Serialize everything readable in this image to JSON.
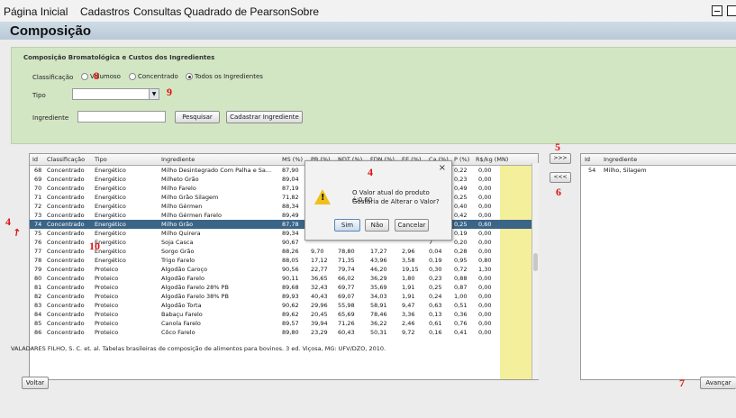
{
  "menu": [
    "Página Inicial",
    "Cadastros",
    "Consultas",
    "Quadrado de Pearson",
    "Sobre"
  ],
  "window_title": "Composição",
  "section_title": "Composição Bromatológica e Custos dos Ingredientes",
  "classificacao": {
    "label": "Classificação",
    "options": [
      "Volumoso",
      "Concentrado",
      "Todos os Ingredientes"
    ],
    "selected": "Todos os Ingredientes"
  },
  "tipo": {
    "label": "Tipo",
    "value": ""
  },
  "ingrediente": {
    "label": "Ingrediente",
    "value": ""
  },
  "buttons": {
    "pesquisar": "Pesquisar",
    "cadastrar": "Cadastrar Ingrediente",
    "add": ">>>",
    "remove": "<<<",
    "voltar": "Voltar",
    "avancar": "Avançar"
  },
  "table": {
    "columns": [
      "Id",
      "Classificação",
      "Tipo",
      "Ingrediente",
      "MS (%)",
      "PB (%)",
      "NDT (%)",
      "FDN (%)",
      "EE (%)",
      "Ca (%)",
      "P (%)",
      "R$/kg (MN)"
    ],
    "selected_id": "74",
    "rows": [
      [
        "68",
        "Concentrado",
        "Energético",
        "Milho Desintegrado Com Palha e Sa...",
        "87,90",
        "",
        "",
        "",
        "",
        "5",
        "0,22",
        "0,00"
      ],
      [
        "69",
        "Concentrado",
        "Energético",
        "Milheto Grão",
        "89,04",
        "",
        "",
        "",
        "",
        "5",
        "0,23",
        "0,00"
      ],
      [
        "70",
        "Concentrado",
        "Energético",
        "Milho Farelo",
        "87,19",
        "",
        "",
        "",
        "",
        "5",
        "0,49",
        "0,00"
      ],
      [
        "71",
        "Concentrado",
        "Energético",
        "Milho Grão Silagem",
        "71,82",
        "",
        "",
        "",
        "",
        "3",
        "0,25",
        "0,00"
      ],
      [
        "72",
        "Concentrado",
        "Energético",
        "Milho Gérmen",
        "88,34",
        "",
        "",
        "",
        "",
        "3",
        "0,40",
        "0,00"
      ],
      [
        "73",
        "Concentrado",
        "Energético",
        "Milho Gérmen Farelo",
        "89,49",
        "",
        "",
        "",
        "",
        "3",
        "0,42",
        "0,00"
      ],
      [
        "74",
        "Concentrado",
        "Energético",
        "Milho Grão",
        "87,78",
        "",
        "",
        "",
        "",
        "3",
        "0,25",
        "0,60"
      ],
      [
        "75",
        "Concentrado",
        "Energético",
        "Milho Quirera",
        "89,34",
        "",
        "",
        "",
        "",
        "7",
        "0,19",
        "0,00"
      ],
      [
        "76",
        "Concentrado",
        "Energético",
        "Soja Casca",
        "90,67",
        "",
        "",
        "",
        "",
        "7",
        "0,20",
        "0,00"
      ],
      [
        "77",
        "Concentrado",
        "Energético",
        "Sorgo Grão",
        "88,26",
        "9,70",
        "78,80",
        "17,27",
        "2,96",
        "0,04",
        "0,28",
        "0,00"
      ],
      [
        "78",
        "Concentrado",
        "Energético",
        "Trigo Farelo",
        "88,05",
        "17,12",
        "71,35",
        "43,96",
        "3,58",
        "0,19",
        "0,95",
        "0,80"
      ],
      [
        "79",
        "Concentrado",
        "Proteico",
        "Algodão Caroço",
        "90,56",
        "22,77",
        "79,74",
        "46,20",
        "19,15",
        "0,30",
        "0,72",
        "1,30"
      ],
      [
        "80",
        "Concentrado",
        "Proteico",
        "Algodão Farelo",
        "90,11",
        "36,65",
        "66,02",
        "36,29",
        "1,80",
        "0,23",
        "0,88",
        "0,00"
      ],
      [
        "81",
        "Concentrado",
        "Proteico",
        "Algodão Farelo 28% PB",
        "89,68",
        "32,43",
        "69,77",
        "35,69",
        "1,91",
        "0,25",
        "0,87",
        "0,00"
      ],
      [
        "82",
        "Concentrado",
        "Proteico",
        "Algodão Farelo 38% PB",
        "89,93",
        "40,43",
        "69,07",
        "34,03",
        "1,91",
        "0,24",
        "1,00",
        "0,00"
      ],
      [
        "83",
        "Concentrado",
        "Proteico",
        "Algodão Torta",
        "90,62",
        "29,96",
        "55,98",
        "58,91",
        "9,47",
        "0,63",
        "0,51",
        "0,00"
      ],
      [
        "84",
        "Concentrado",
        "Proteico",
        "Babaçu Farelo",
        "89,62",
        "20,45",
        "65,69",
        "78,46",
        "3,36",
        "0,13",
        "0,36",
        "0,00"
      ],
      [
        "85",
        "Concentrado",
        "Proteico",
        "Canola Farelo",
        "89,57",
        "39,94",
        "71,26",
        "36,22",
        "2,46",
        "0,61",
        "0,76",
        "0,00"
      ],
      [
        "86",
        "Concentrado",
        "Proteico",
        "Côco Farelo",
        "89,80",
        "23,29",
        "60,43",
        "50,31",
        "9,72",
        "0,16",
        "0,41",
        "0,00"
      ]
    ]
  },
  "selected_table": {
    "columns": [
      "Id",
      "Ingrediente"
    ],
    "rows": [
      [
        "54",
        "Milho, Silagem"
      ]
    ]
  },
  "dialog": {
    "message_line1": "O Valor atual do produto é:0,60",
    "message_line2": "Gostaria de Alterar o Valor?",
    "yes": "Sim",
    "no": "Não",
    "cancel": "Cancelar",
    "close": "×"
  },
  "reference": "VALADARES FILHO, S. C. et. al. Tabelas brasileiras de composição de alimentos para bovinos. 3 ed. Viçosa, MG: UFV/DZO, 2010.",
  "annotations": [
    "4",
    "4",
    "5",
    "6",
    "7",
    "8",
    "9",
    "10"
  ],
  "colors": {
    "selected_row": "#3b6587",
    "price_column": "#f4ef9a",
    "form_panel": "#d3e6c4",
    "annotation": "#dd1111"
  }
}
